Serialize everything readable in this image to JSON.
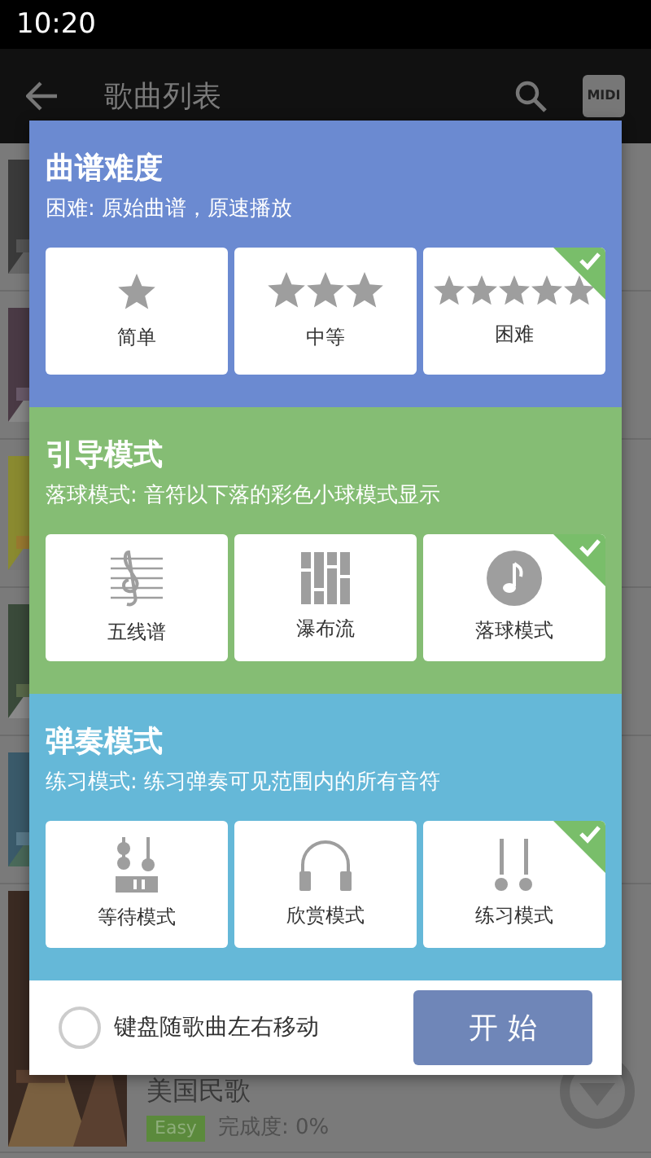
{
  "status_bar": {
    "time": "10:20"
  },
  "app_bar": {
    "title": "歌曲列表",
    "midi_label": "MIDI"
  },
  "song_list": {
    "visible_row": {
      "title": "美国民歌",
      "level_badge": "Easy",
      "progress": "完成度: 0%"
    }
  },
  "dialog": {
    "sections": [
      {
        "color": "#6b8ad1",
        "title": "曲谱难度",
        "description": "困难: 原始曲谱，原速播放",
        "options": [
          {
            "kind": "star1",
            "label": "简单",
            "selected": false
          },
          {
            "kind": "star3",
            "label": "中等",
            "selected": false
          },
          {
            "kind": "star5",
            "label": "困难",
            "selected": true
          }
        ]
      },
      {
        "color": "#85bd74",
        "title": "引导模式",
        "description": "落球模式: 音符以下落的彩色小球模式显示",
        "options": [
          {
            "kind": "staff",
            "label": "五线谱",
            "selected": false
          },
          {
            "kind": "waterfall",
            "label": "瀑布流",
            "selected": false
          },
          {
            "kind": "ball",
            "label": "落球模式",
            "selected": true
          }
        ]
      },
      {
        "color": "#65b8d8",
        "title": "弹奏模式",
        "description": "练习模式: 练习弹奏可见范围内的所有音符",
        "options": [
          {
            "kind": "wait",
            "label": "等待模式",
            "selected": false
          },
          {
            "kind": "listen",
            "label": "欣赏模式",
            "selected": false
          },
          {
            "kind": "practice",
            "label": "练习模式",
            "selected": true
          }
        ]
      }
    ],
    "keyboard_follow": {
      "label": "键盘随歌曲左右移动",
      "checked": false
    },
    "start_button": "开 始"
  }
}
